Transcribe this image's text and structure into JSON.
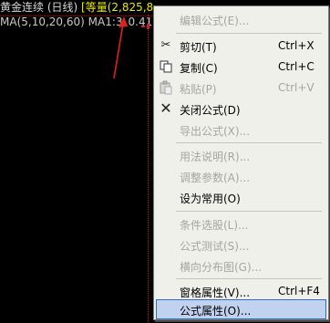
{
  "chart": {
    "title": {
      "name": "黄金连续 (日线)",
      "volume_label": "[等量(2,825,8",
      "hidden_tail": "）"
    },
    "ma_line": "MA(5,10,20,60) MA1:3",
    "ma_tail": "0.41"
  },
  "menu": {
    "items": [
      {
        "label": "编辑公式(E)...",
        "shortcut": "",
        "icon": "",
        "enabled": false
      },
      {
        "label": "剪切(T)",
        "shortcut": "Ctrl+X",
        "icon": "scissors-icon",
        "enabled": true
      },
      {
        "label": "复制(C)",
        "shortcut": "Ctrl+C",
        "icon": "copy-icon",
        "enabled": true
      },
      {
        "label": "粘贴(P)",
        "shortcut": "Ctrl+V",
        "icon": "paste-icon",
        "enabled": false
      },
      {
        "label": "关闭公式(D)",
        "shortcut": "",
        "icon": "close-icon",
        "enabled": true
      },
      {
        "label": "导出公式(X)...",
        "shortcut": "",
        "icon": "",
        "enabled": false
      },
      {
        "label": "用法说明(R)...",
        "shortcut": "",
        "icon": "",
        "enabled": false
      },
      {
        "label": "调整参数(A)...",
        "shortcut": "",
        "icon": "",
        "enabled": false
      },
      {
        "label": "设为常用(O)",
        "shortcut": "",
        "icon": "",
        "enabled": true
      },
      {
        "label": "条件选股(L)...",
        "shortcut": "",
        "icon": "",
        "enabled": false
      },
      {
        "label": "公式测试(S)...",
        "shortcut": "",
        "icon": "",
        "enabled": false
      },
      {
        "label": "横向分布图(G)...",
        "shortcut": "",
        "icon": "",
        "enabled": false
      },
      {
        "label": "窗格属性(V)...",
        "shortcut": "Ctrl+F4",
        "icon": "",
        "enabled": true
      },
      {
        "label": "公式属性(O)...",
        "shortcut": "",
        "icon": "",
        "enabled": true,
        "selected": true
      }
    ]
  },
  "colors": {
    "menu_bg": "#f0f0eb",
    "highlight": "#c1d2ee",
    "disabled_text": "#a6a6a0",
    "chart_red": "#d02020",
    "volume_yellow": "#e8e800"
  }
}
